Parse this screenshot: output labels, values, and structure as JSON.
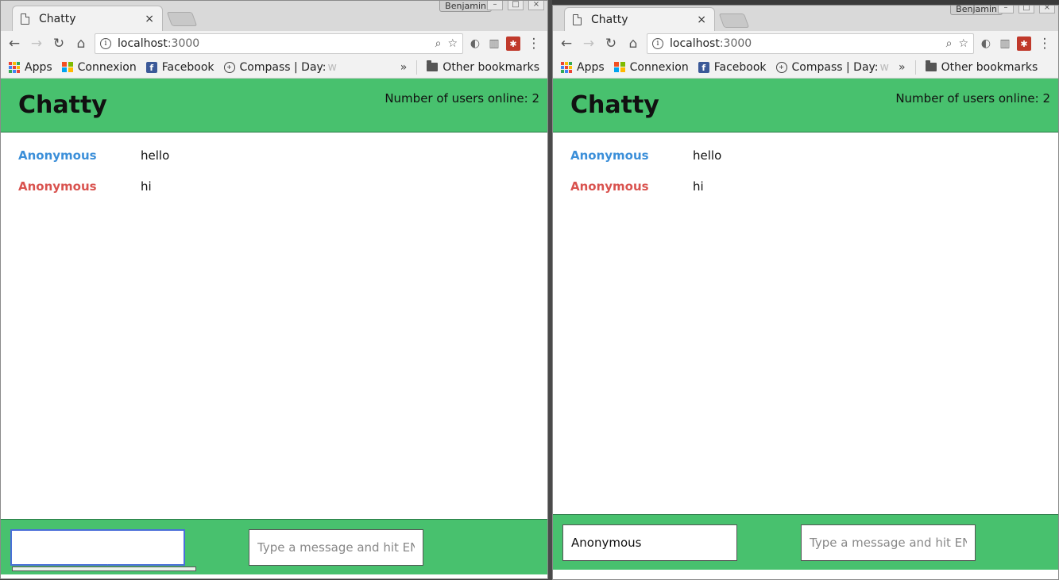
{
  "windows": {
    "left": {
      "tab_title": "Chatty",
      "tab_close": "×",
      "profile": "Benjamin",
      "url_host": "localhost",
      "url_port": ":3000",
      "bookmarks": {
        "apps": "Apps",
        "connexion": "Connexion",
        "facebook": "Facebook",
        "compass": "Compass | Day:",
        "compass_fade": "w",
        "more": "»",
        "other": "Other bookmarks"
      },
      "app": {
        "brand": "Chatty",
        "users_online": "Number of users online: 2",
        "messages": [
          {
            "user": "Anonymous",
            "content": "hello",
            "color": "#3b8fd9"
          },
          {
            "user": "Anonymous",
            "content": "hi",
            "color": "#d9534f"
          }
        ],
        "username_value": "",
        "message_placeholder": "Type a message and hit ENTER"
      }
    },
    "right": {
      "tab_title": "Chatty",
      "tab_close": "×",
      "profile": "Benjamin",
      "url_host": "localhost",
      "url_port": ":3000",
      "bookmarks": {
        "apps": "Apps",
        "connexion": "Connexion",
        "facebook": "Facebook",
        "compass": "Compass | Day:",
        "compass_fade": "w",
        "more": "»",
        "other": "Other bookmarks"
      },
      "app": {
        "brand": "Chatty",
        "users_online": "Number of users online: 2",
        "messages": [
          {
            "user": "Anonymous",
            "content": "hello",
            "color": "#3b8fd9"
          },
          {
            "user": "Anonymous",
            "content": "hi",
            "color": "#d9534f"
          }
        ],
        "username_value": "Anonymous",
        "message_placeholder": "Type a message and hit ENTER"
      }
    }
  },
  "colors": {
    "navbar_green": "#48c16e",
    "user_blue": "#3b8fd9",
    "user_red": "#d9534f"
  }
}
